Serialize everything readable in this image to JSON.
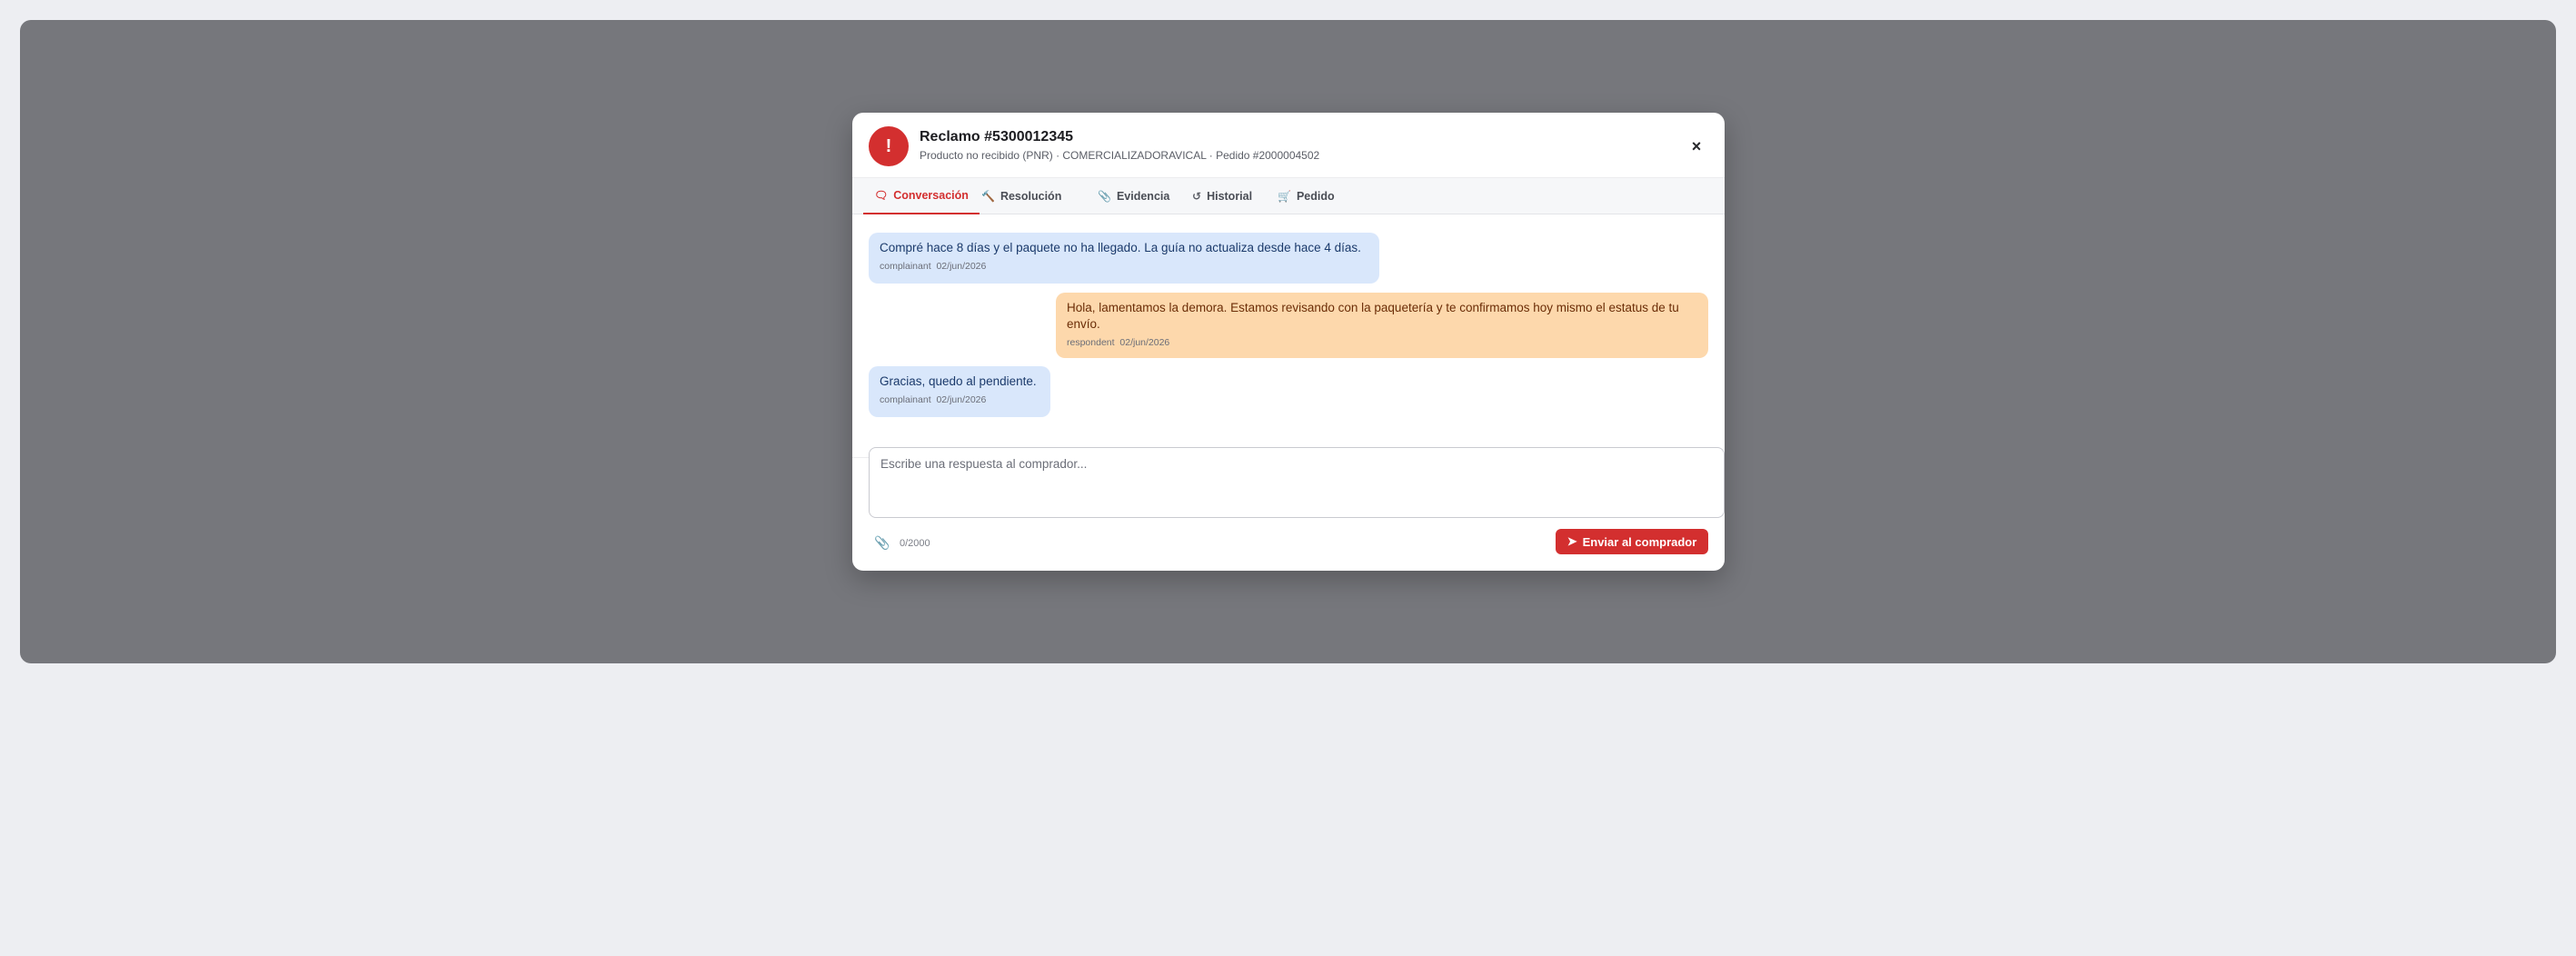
{
  "claim": {
    "title": "Reclamo #5300012345",
    "subtitle": "Producto no recibido (PNR) · COMERCIALIZADORAVICAL · Pedido #2000004502",
    "alert_glyph": "!",
    "close_glyph": "×"
  },
  "tabs": [
    {
      "label": "Conversación",
      "icon": "chat-icon",
      "active": true
    },
    {
      "label": "Resolución",
      "icon": "gavel-icon",
      "active": false
    },
    {
      "label": "Evidencia",
      "icon": "paperclip-icon",
      "active": false
    },
    {
      "label": "Historial",
      "icon": "history-icon",
      "active": false
    },
    {
      "label": "Pedido",
      "icon": "cart-icon",
      "active": false
    }
  ],
  "messages": [
    {
      "text": "Compré hace 8 días y el paquete no ha llegado. La guía no actualiza desde hace 4 días.",
      "role": "complainant",
      "date": "02/jun/2026"
    },
    {
      "text": "Hola, lamentamos la demora. Estamos revisando con la paquetería y te confirmamos hoy mismo el estatus de tu envío.",
      "role": "respondent",
      "date": "02/jun/2026"
    },
    {
      "text": "Gracias, quedo al pendiente.",
      "role": "complainant",
      "date": "02/jun/2026"
    }
  ],
  "composer": {
    "placeholder": "Escribe una respuesta al comprador...",
    "counter": "0/2000",
    "send_label": "Enviar al comprador",
    "send_icon": "paper-plane-icon",
    "attach_icon": "paperclip-icon"
  },
  "colors": {
    "accent": "#d32f2f",
    "buyer_bubble": "#d9e7fb",
    "seller_bubble": "#fdd8ac",
    "backdrop": "#76777c"
  }
}
